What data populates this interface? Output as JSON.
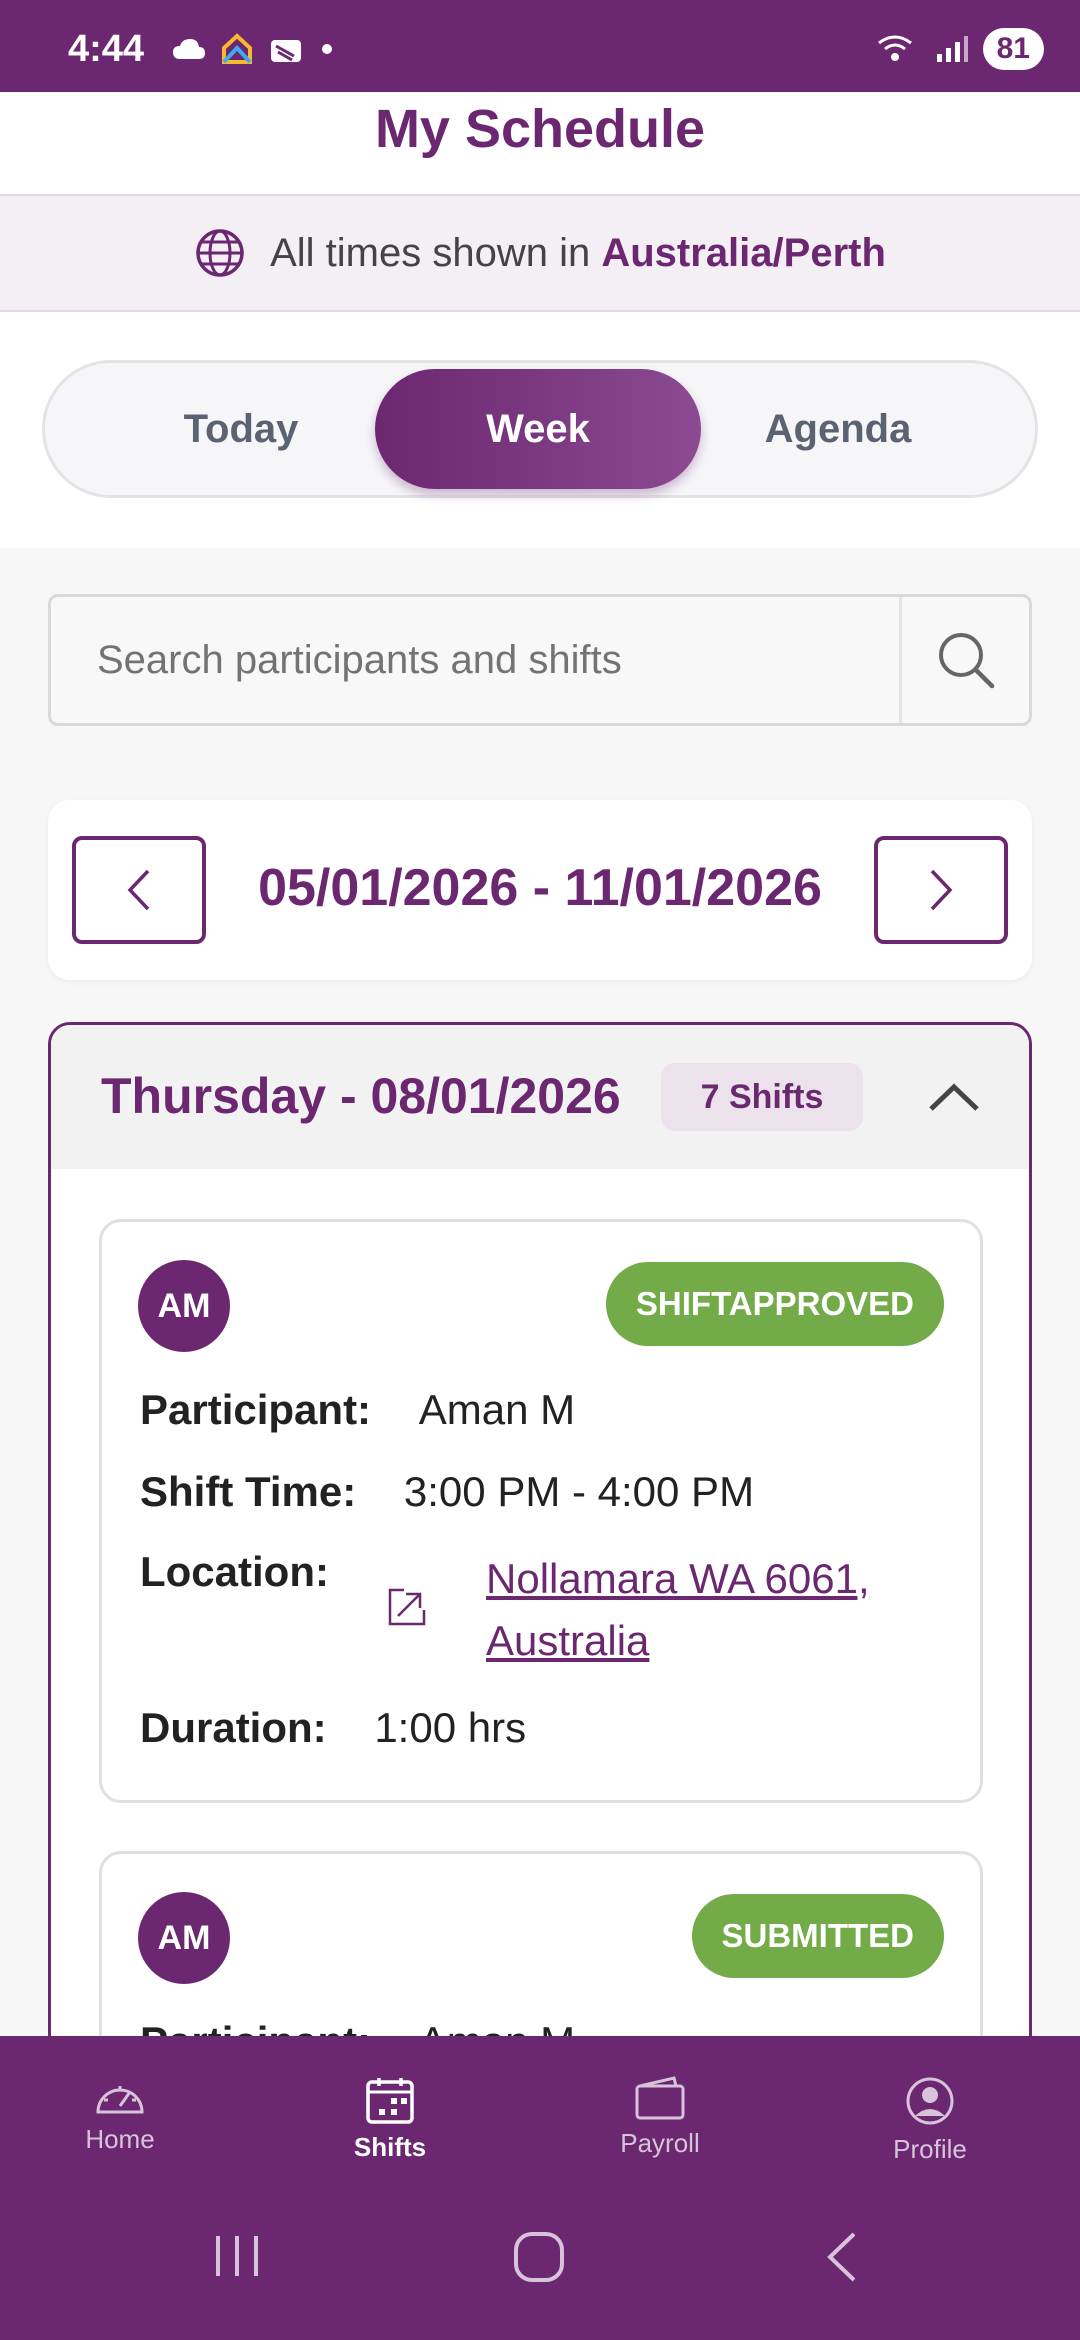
{
  "status_bar": {
    "time": "4:44",
    "battery": "81"
  },
  "header": {
    "title": "My Schedule"
  },
  "timezone": {
    "prefix": "All times shown in",
    "zone": "Australia/Perth"
  },
  "tabs": [
    {
      "label": "Today",
      "active": false
    },
    {
      "label": "Week",
      "active": true
    },
    {
      "label": "Agenda",
      "active": false
    }
  ],
  "search": {
    "placeholder": "Search participants and shifts",
    "value": ""
  },
  "week": {
    "range": "05/01/2026 - 11/01/2026"
  },
  "day": {
    "title": "Thursday - 08/01/2026",
    "shift_count": "7 Shifts"
  },
  "labels": {
    "participant": "Participant:",
    "shift_time": "Shift Time:",
    "location": "Location:",
    "duration": "Duration:"
  },
  "shifts": [
    {
      "initials": "AM",
      "status": "SHIFTAPPROVED",
      "participant": "Aman M",
      "time": "3:00 PM - 4:00 PM",
      "location_line1": "Nollamara WA 6061,",
      "location_line2": "Australia",
      "duration": "1:00 hrs"
    },
    {
      "initials": "AM",
      "status": "SUBMITTED",
      "participant": "Aman M"
    }
  ],
  "bottom_nav": [
    {
      "label": "Home",
      "icon": "speedometer-icon",
      "active": false
    },
    {
      "label": "Shifts",
      "icon": "calendar-icon",
      "active": true
    },
    {
      "label": "Payroll",
      "icon": "wallet-icon",
      "active": false
    },
    {
      "label": "Profile",
      "icon": "profile-icon",
      "active": false
    }
  ]
}
